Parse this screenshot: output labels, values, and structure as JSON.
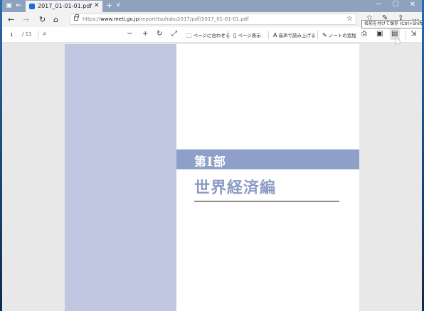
{
  "titlebar": {
    "tab_title": "2017_01-01-01.pdf",
    "tab_close": "✕",
    "new_tab": "+",
    "tab_menu": "∨",
    "minimize": "─",
    "maximize": "☐",
    "close": "✕"
  },
  "address": {
    "scheme": "https://",
    "host": "www.meti.go.jp",
    "path": "/report/tsuhaku2017/pdf/2017_01-01-01.pdf"
  },
  "tooltip": "名前を付けて保存 (Ctrl+Shift+S)",
  "pdf_toolbar": {
    "current_page": "1",
    "total_pages": "/ 11",
    "fit_page_label": "ページに合わせる",
    "page_view_label": "ページ表示",
    "read_aloud_label": "音声で読み上げる",
    "add_notes_label": "ノートの追加"
  },
  "document": {
    "part_label": "第Ⅰ部",
    "section_title": "世界経済編"
  },
  "colors": {
    "titlebar": "#8ea2bd",
    "page_stripe": "#c1c7e1",
    "part_band": "#8ea0c7",
    "section_title": "#8b9bc3"
  }
}
